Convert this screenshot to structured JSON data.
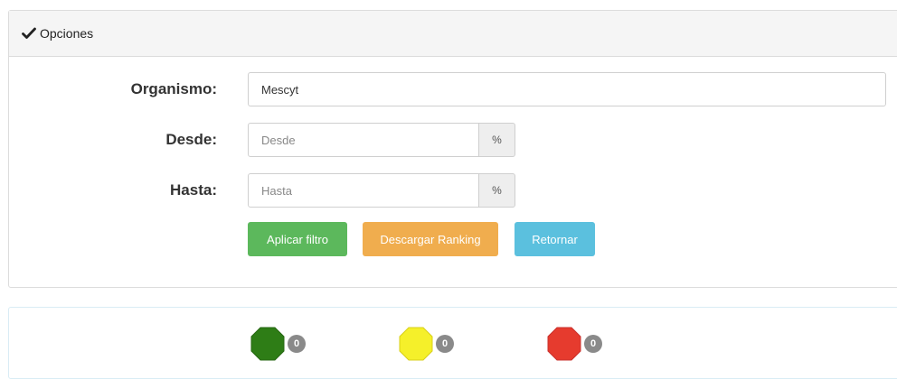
{
  "panel": {
    "title": "Opciones"
  },
  "form": {
    "organismo": {
      "label": "Organismo:",
      "value": "Mescyt"
    },
    "desde": {
      "label": "Desde:",
      "placeholder": "Desde",
      "addon": "%"
    },
    "hasta": {
      "label": "Hasta:",
      "placeholder": "Hasta",
      "addon": "%"
    }
  },
  "buttons": {
    "apply": "Aplicar filtro",
    "download": "Descargar Ranking",
    "back": "Retornar"
  },
  "colors": {
    "green": "#5cb85c",
    "orange": "#f0ad4e",
    "blue": "#5bc0de"
  },
  "indicators": [
    {
      "icon": "green-octagon-icon",
      "color": "#2e7d16",
      "count": "0"
    },
    {
      "icon": "yellow-octagon-icon",
      "color": "#f5f02a",
      "count": "0"
    },
    {
      "icon": "red-octagon-icon",
      "color": "#e63b2e",
      "count": "0"
    }
  ]
}
